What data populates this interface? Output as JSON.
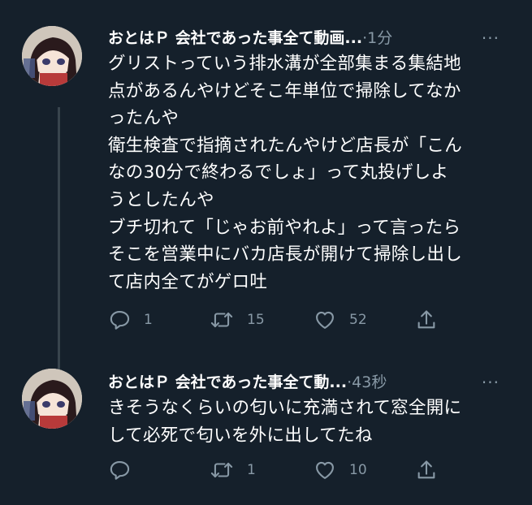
{
  "thread": [
    {
      "author_name": "おとはＰ 会社であった事全て動画...",
      "dot": "·",
      "time": "1分",
      "more": "···",
      "text": "グリストっていう排水溝が全部集まる集結地\n点があるんやけどそこ年単位で掃除してなか\nったんや\n衛生検査で指摘されたんやけど店長が「こん\nなの30分で終わるでしょ」って丸投げしよ\nうとしたんや\nブチ切れて「じゃお前やれよ」って言ったら\nそこを営業中にバカ店長が開けて掃除し出し\nて店内全てがゲロ吐",
      "reply_count": "1",
      "retweet_count": "15",
      "like_count": "52"
    },
    {
      "author_name": "おとはＰ 会社であった事全て動...",
      "dot": "·",
      "time": "43秒",
      "more": "···",
      "text": "きそうなくらいの匂いに充満されて窓全開に\nして必死で匂いを外に出してたね",
      "reply_count": "",
      "retweet_count": "1",
      "like_count": "10"
    }
  ],
  "colors": {
    "background": "#15202b",
    "text": "#ffffff",
    "secondary": "#8899a6",
    "thread_line": "#38444d"
  }
}
